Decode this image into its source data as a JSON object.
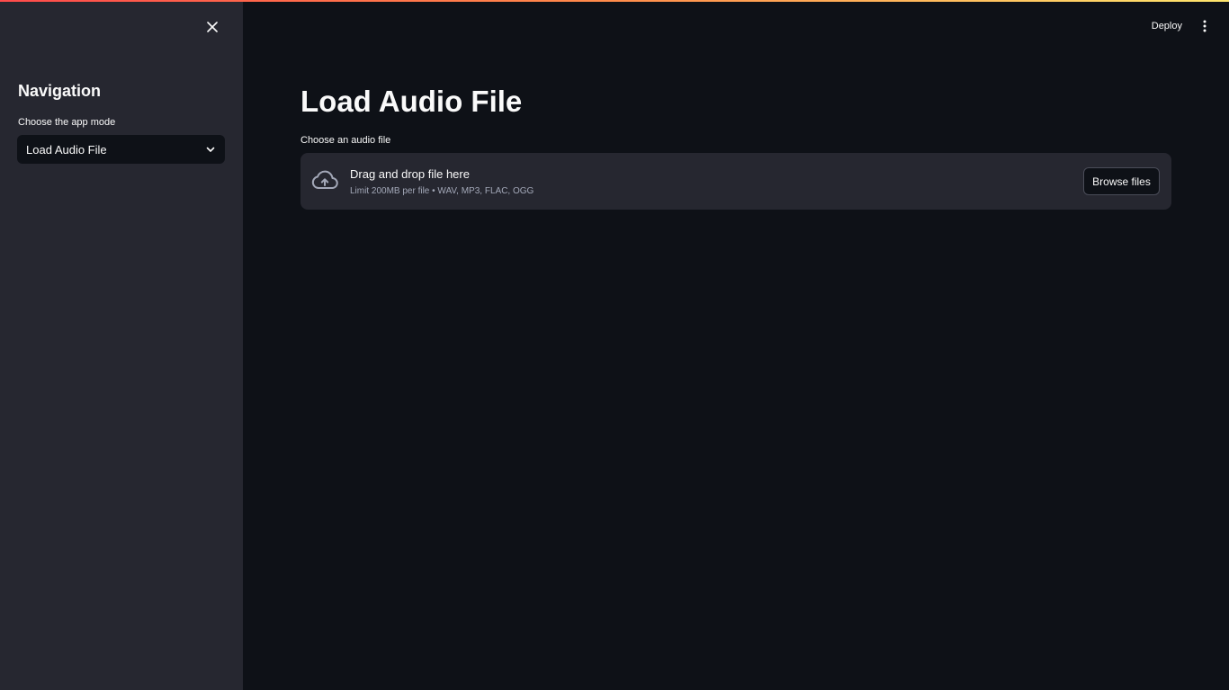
{
  "sidebar": {
    "title": "Navigation",
    "select": {
      "label": "Choose the app mode",
      "value": "Load Audio File"
    }
  },
  "header": {
    "deploy_label": "Deploy"
  },
  "main": {
    "title": "Load Audio File",
    "uploader": {
      "label": "Choose an audio file",
      "drop_text": "Drag and drop file here",
      "limit_text": "Limit 200MB per file • WAV, MP3, FLAC, OGG",
      "browse_label": "Browse files"
    }
  },
  "colors": {
    "background": "#0e1117",
    "sidebar": "#262730",
    "accent_start": "#ff4b4b",
    "accent_end": "#ffe66d"
  },
  "icons": [
    "close-icon",
    "chevron-down-icon",
    "more-vert-icon",
    "cloud-upload-icon"
  ]
}
